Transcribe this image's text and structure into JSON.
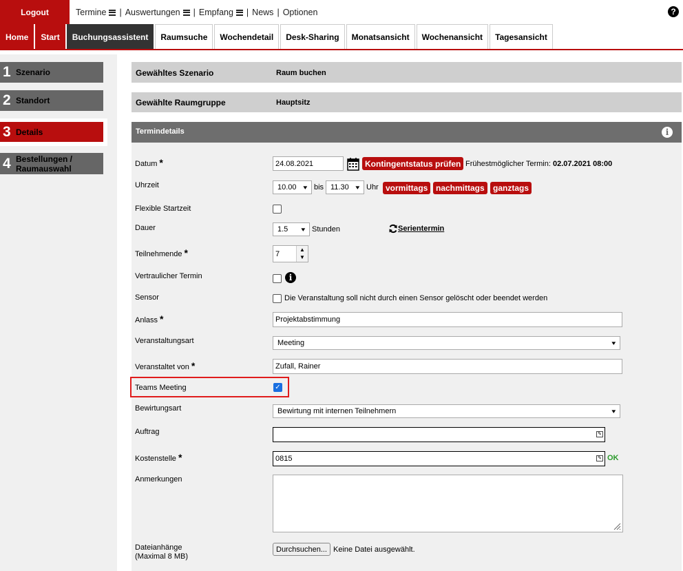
{
  "topbar": {
    "logout": "Logout",
    "menu": [
      "Termine",
      "Auswertungen",
      "Empfang",
      "News",
      "Optionen"
    ],
    "separator": "|"
  },
  "tabs": [
    "Home",
    "Start",
    "Buchungsassistent",
    "Raumsuche",
    "Wochendetail",
    "Desk-Sharing",
    "Monatsansicht",
    "Wochenansicht",
    "Tagesansicht"
  ],
  "steps": [
    {
      "num": "1",
      "label": "Szenario"
    },
    {
      "num": "2",
      "label": "Standort"
    },
    {
      "num": "3",
      "label": "Details"
    },
    {
      "num": "4",
      "label": "Bestellungen / Raumauswahl"
    }
  ],
  "summary": {
    "scenario_label": "Gewähltes Szenario",
    "scenario_value": "Raum buchen",
    "group_label": "Gewählte Raumgruppe",
    "group_value": "Hauptsitz"
  },
  "section_title": "Termindetails",
  "form": {
    "datum_label": "Datum",
    "datum_value": "24.08.2021",
    "kontingent_button": "Kontingentstatus prüfen",
    "earliest_label": "Frühestmöglicher Termin:",
    "earliest_value": "02.07.2021 08:00",
    "uhrzeit_label": "Uhrzeit",
    "time_from": "10.00",
    "bis": "bis",
    "time_to": "11.30",
    "uhr": "Uhr",
    "vormittags": "vormittags",
    "nachmittags": "nachmittags",
    "ganztags": "ganztags",
    "flex_label": "Flexible Startzeit",
    "dauer_label": "Dauer",
    "dauer_value": "1.5",
    "stunden": "Stunden",
    "serientermin": "Serientermin",
    "teilnehmende_label": "Teilnehmende",
    "teilnehmende_value": "7",
    "vertraulich_label": "Vertraulicher Termin",
    "sensor_label": "Sensor",
    "sensor_text": "Die Veranstaltung soll nicht durch einen Sensor gelöscht oder beendet werden",
    "anlass_label": "Anlass",
    "anlass_value": "Projektabstimmung",
    "veranstaltungsart_label": "Veranstaltungsart",
    "veranstaltungsart_value": "Meeting",
    "veranstaltet_label": "Veranstaltet von",
    "veranstaltet_value": "Zufall, Rainer",
    "teams_label": "Teams Meeting",
    "teams_checked": true,
    "bewirtung_label": "Bewirtungsart",
    "bewirtung_value": "Bewirtung mit internen Teilnehmern",
    "auftrag_label": "Auftrag",
    "auftrag_value": "",
    "kosten_label": "Kostenstelle",
    "kosten_value": "0815",
    "kosten_status": "OK",
    "anmerkungen_label": "Anmerkungen",
    "anhang_label_1": "Dateianhänge",
    "anhang_label_2": "(Maximal 8 MB)",
    "file_button": "Durchsuchen...",
    "file_status": "Keine Datei ausgewählt."
  },
  "colors": {
    "brand_red": "#b80e0e",
    "dark_tab": "#333333",
    "highlight": "#e01b1b",
    "checkbox_blue": "#1a6fe0",
    "ok_green": "#2a9a2a"
  }
}
